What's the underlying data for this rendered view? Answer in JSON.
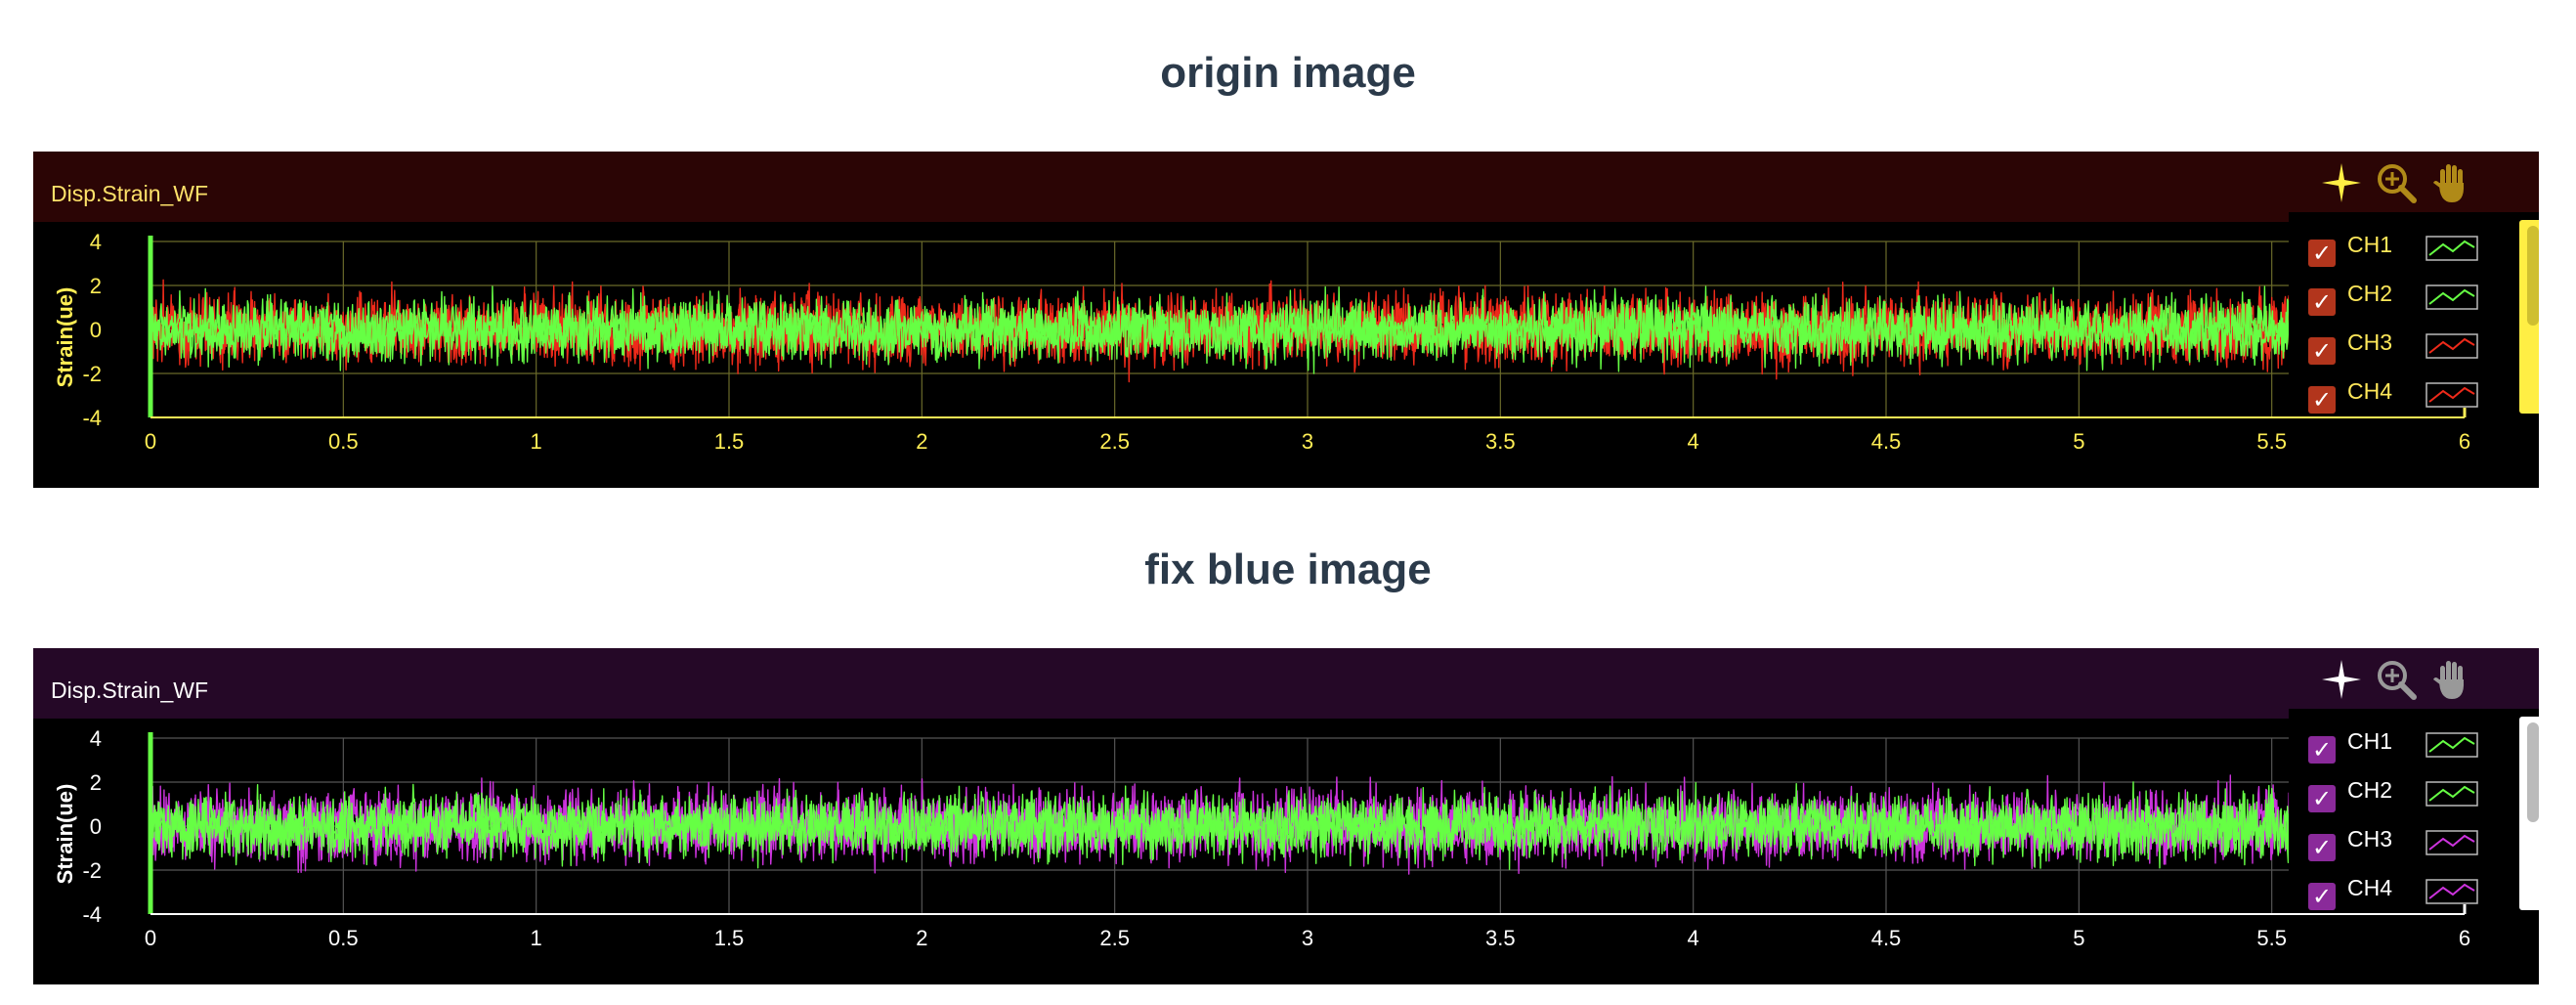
{
  "headings": {
    "origin": "origin image",
    "fix": "fix blue image"
  },
  "panels": [
    {
      "title": "Disp.Strain_WF",
      "colors": {
        "header_bg": "#2b0505",
        "title": "#ffe26a",
        "axis": "#ffee55",
        "tick_label": "#ffee55",
        "grid": "#6a6a2a",
        "toolbar": "#ffee44",
        "toolbar_dim": "#b08a18",
        "check_bg": "#b2351c",
        "legend_text": "#ffe85a",
        "scroll_track": "#ffee44",
        "scroll_thumb": "#cfbf30"
      },
      "toolbar": {
        "crosshair": "crosshair-icon",
        "zoom": "zoom-in-icon",
        "pan": "hand-pan-icon"
      },
      "legend": [
        {
          "label": "CH1",
          "checked": true,
          "color": "#66ff44"
        },
        {
          "label": "CH2",
          "checked": true,
          "color": "#66ff44"
        },
        {
          "label": "CH3",
          "checked": true,
          "color": "#ee2a1a"
        },
        {
          "label": "CH4",
          "checked": true,
          "color": "#ee2a1a"
        }
      ]
    },
    {
      "title": "Disp.Strain_WF",
      "colors": {
        "header_bg": "#250827",
        "title": "#ffffff",
        "axis": "#ffffff",
        "tick_label": "#ffffff",
        "grid": "#555555",
        "toolbar": "#ffffff",
        "toolbar_dim": "#999999",
        "check_bg": "#8a2a9a",
        "legend_text": "#ffffff",
        "scroll_track": "#ffffff",
        "scroll_thumb": "#bbbbbb"
      },
      "toolbar": {
        "crosshair": "crosshair-icon",
        "zoom": "zoom-in-icon",
        "pan": "hand-pan-icon"
      },
      "legend": [
        {
          "label": "CH1",
          "checked": true,
          "color": "#66ff44"
        },
        {
          "label": "CH2",
          "checked": true,
          "color": "#66ff44"
        },
        {
          "label": "CH3",
          "checked": true,
          "color": "#cc33dd"
        },
        {
          "label": "CH4",
          "checked": true,
          "color": "#cc33dd"
        }
      ]
    }
  ],
  "chart_data": [
    {
      "type": "line",
      "title": "Disp.Strain_WF",
      "xlabel": "",
      "ylabel": "Strain(ue)",
      "xlim": [
        0,
        6
      ],
      "ylim": [
        -4,
        4
      ],
      "xticks": [
        "0",
        "0.5",
        "1",
        "1.5",
        "2",
        "2.5",
        "3",
        "3.5",
        "4",
        "4.5",
        "5",
        "5.5",
        "6"
      ],
      "yticks": [
        "4",
        "2",
        "0",
        "-2",
        "-4"
      ],
      "x_data_end": 5.55,
      "grid": true,
      "legend_position": "top-right",
      "series": [
        {
          "name": "CH1",
          "color": "#66ff44",
          "noise_amplitude": 2.3
        },
        {
          "name": "CH2",
          "color": "#66ff44",
          "noise_amplitude": 2.3
        },
        {
          "name": "CH3",
          "color": "#ee2a1a",
          "noise_amplitude": 2.6
        },
        {
          "name": "CH4",
          "color": "#ee2a1a",
          "noise_amplitude": 2.6
        }
      ]
    },
    {
      "type": "line",
      "title": "Disp.Strain_WF",
      "xlabel": "",
      "ylabel": "Strain(ue)",
      "xlim": [
        0,
        6
      ],
      "ylim": [
        -4,
        4
      ],
      "xticks": [
        "0",
        "0.5",
        "1",
        "1.5",
        "2",
        "2.5",
        "3",
        "3.5",
        "4",
        "4.5",
        "5",
        "5.5",
        "6"
      ],
      "yticks": [
        "4",
        "2",
        "0",
        "-2",
        "-4"
      ],
      "x_data_end": 5.55,
      "grid": true,
      "legend_position": "top-right",
      "series": [
        {
          "name": "CH1",
          "color": "#66ff44",
          "noise_amplitude": 2.3
        },
        {
          "name": "CH2",
          "color": "#66ff44",
          "noise_amplitude": 2.3
        },
        {
          "name": "CH3",
          "color": "#cc33dd",
          "noise_amplitude": 2.6
        },
        {
          "name": "CH4",
          "color": "#cc33dd",
          "noise_amplitude": 2.6
        }
      ]
    }
  ]
}
